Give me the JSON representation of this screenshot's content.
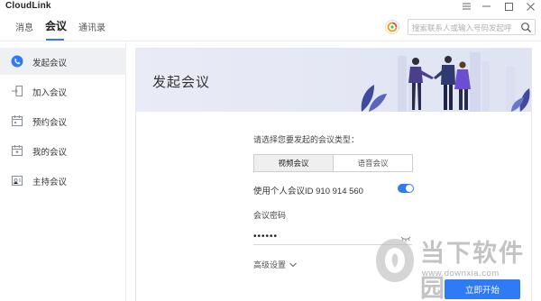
{
  "app": {
    "title": "CloudLink"
  },
  "window_controls": {
    "menu_icon": "hamburger-icon",
    "minimize_icon": "minimize-icon",
    "maximize_icon": "maximize-icon",
    "close_icon": "close-icon"
  },
  "topnav": {
    "tabs": [
      {
        "label": "消息",
        "active": false
      },
      {
        "label": "会议",
        "active": true
      },
      {
        "label": "通讯录",
        "active": false
      }
    ],
    "search_placeholder": "搜索联系人或输入号码发起呼",
    "search_icon": "search-icon",
    "avatar_icon": "avatar-icon"
  },
  "sidebar": {
    "items": [
      {
        "label": "发起会议",
        "icon": "start-meeting-icon",
        "active": true
      },
      {
        "label": "加入会议",
        "icon": "join-meeting-icon",
        "active": false
      },
      {
        "label": "预约会议",
        "icon": "schedule-meeting-icon",
        "active": false
      },
      {
        "label": "我的会议",
        "icon": "my-meetings-icon",
        "active": false
      },
      {
        "label": "主持会议",
        "icon": "host-meeting-icon",
        "active": false
      }
    ]
  },
  "main": {
    "banner_title": "发起会议",
    "prompt": "请选择您要发起的会议类型：",
    "meeting_types": [
      {
        "label": "视频会议",
        "selected": true
      },
      {
        "label": "语音会议",
        "selected": false
      }
    ],
    "pmi_label": "使用个人会议ID 910 914 560",
    "pmi_toggle_on": true,
    "password_label": "会议密码",
    "password_value": "••••••",
    "advanced_label": "高级设置",
    "start_button": "立即开始"
  },
  "watermark": {
    "text": "当下软件园",
    "url": "www.downxia.com"
  },
  "colors": {
    "accent": "#2f7bf5",
    "sidebar_active_bg": "#eef0f4",
    "banner_bg": "#e6e9f5"
  }
}
